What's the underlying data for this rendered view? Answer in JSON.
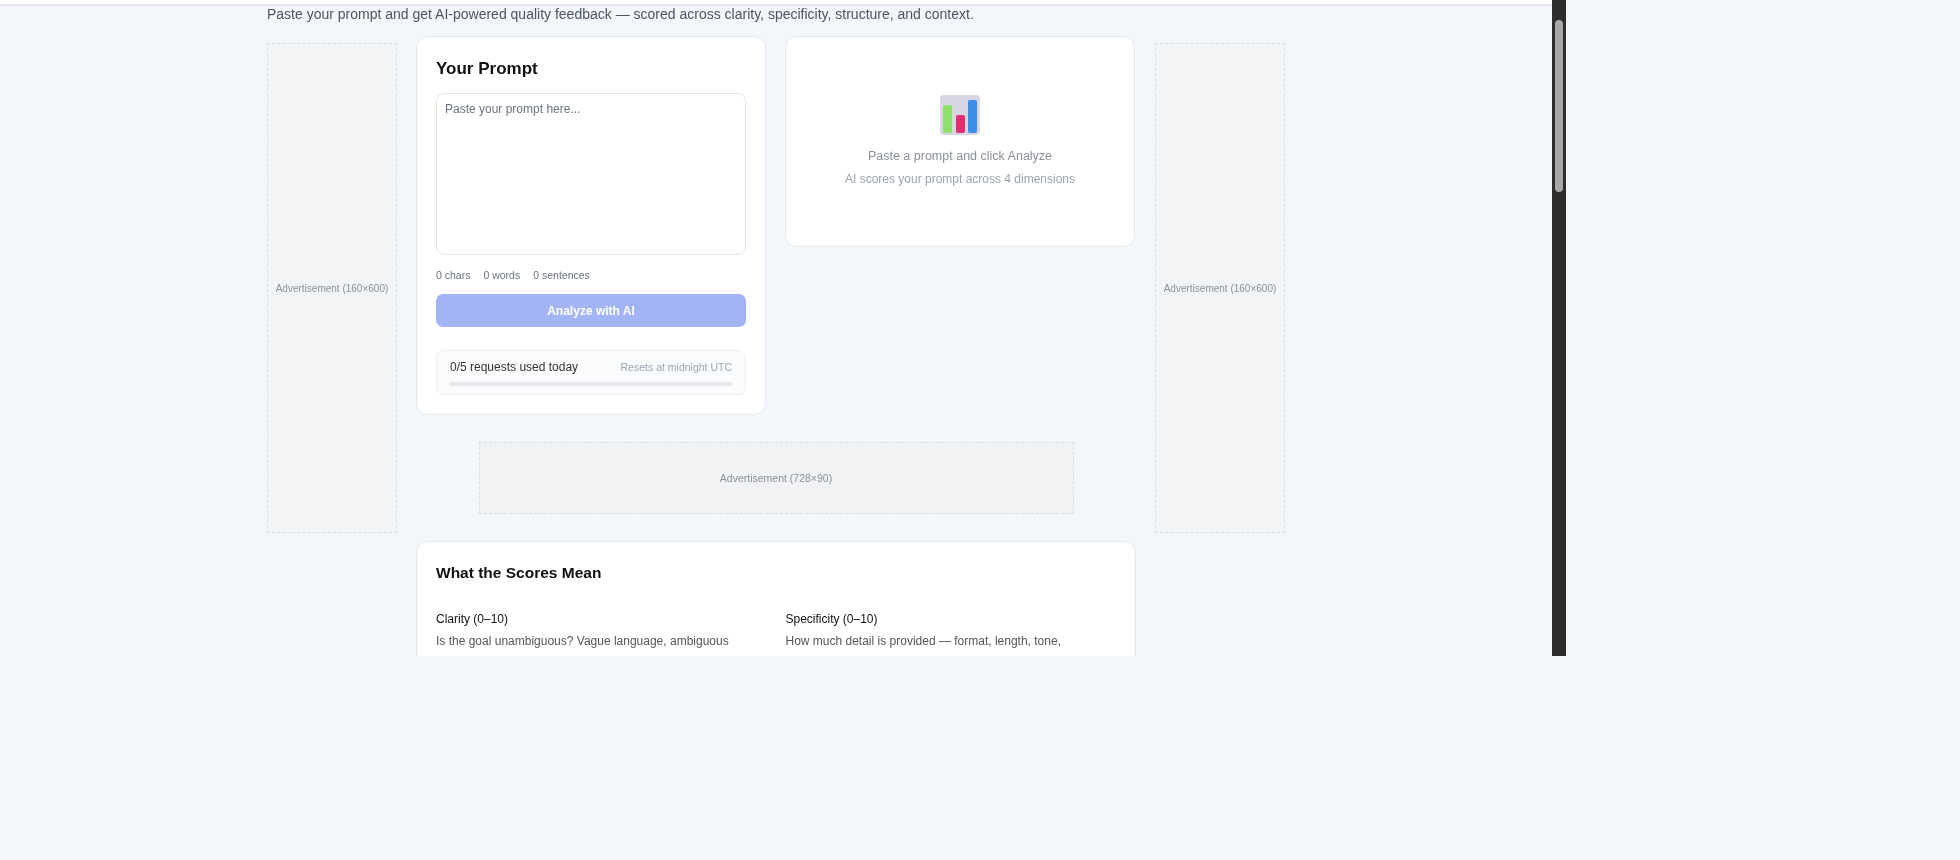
{
  "header_subtitle": "Paste your prompt and get AI-powered quality feedback — scored across clarity, specificity, structure, and context.",
  "left_ad": {
    "label": "Advertisement (160×600)"
  },
  "prompt_card": {
    "title": "Your Prompt",
    "placeholder": "Paste your prompt here...",
    "stats": [
      "0 chars",
      "0 words",
      "0 sentences"
    ],
    "analyze_button": {
      "label": "Analyze with AI",
      "disabled": true
    },
    "usage": {
      "text": "0/5 requests used today",
      "reset": "Resets at midnight UTC",
      "level": 0
    }
  },
  "results_card": {
    "message": "Paste a prompt and click Analyze",
    "hint": "AI scores your prompt across 4 dimensions"
  },
  "right_ad": {
    "label": "Advertisement (160×600)"
  },
  "banner_ad": {
    "label": "Advertisement (728×90)"
  },
  "scores_card": {
    "title": "What the Scores Mean",
    "items": [
      {
        "name": "Clarity (0–10)",
        "description": "Is the goal unambiguous? Vague language, ambiguous"
      },
      {
        "name": "Specificity (0–10)",
        "description": "How much detail is provided — format, length, tone,"
      }
    ]
  }
}
